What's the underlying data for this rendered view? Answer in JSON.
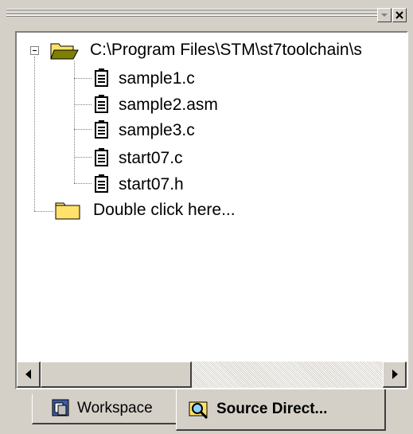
{
  "tree": {
    "root": {
      "label": "C:\\Program Files\\STM\\st7toolchain\\s",
      "icon": "folder-open-icon"
    },
    "files": [
      {
        "label": "sample1.c",
        "icon": "document-icon"
      },
      {
        "label": "sample2.asm",
        "icon": "document-icon"
      },
      {
        "label": "sample3.c",
        "icon": "document-icon"
      },
      {
        "label": "start07.c",
        "icon": "document-icon"
      },
      {
        "label": "start07.h",
        "icon": "document-icon"
      }
    ],
    "add_folder": {
      "label": "Double click here...",
      "icon": "folder-closed-icon"
    }
  },
  "tabs": [
    {
      "label": "Workspace",
      "icon": "workspace-icon",
      "active": false
    },
    {
      "label": "Source Direct...",
      "icon": "source-browse-icon",
      "active": true
    }
  ],
  "colors": {
    "window_bg": "#d4d0c8",
    "folder_yellow": "#ffe26a",
    "folder_open": "#808000"
  }
}
